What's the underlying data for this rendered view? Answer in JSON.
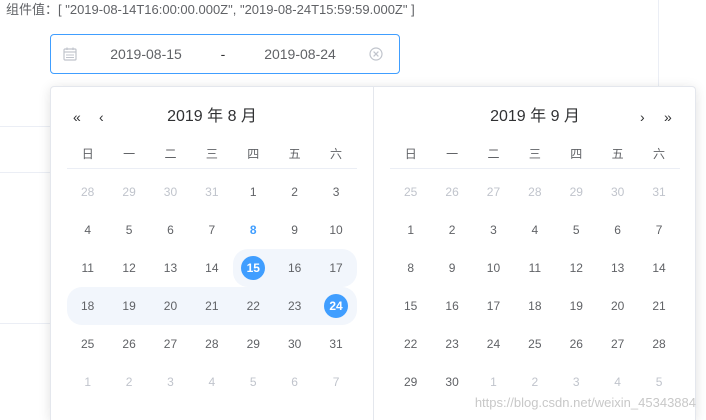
{
  "value_line": "组件值：[ \"2019-08-14T16:00:00.000Z\", \"2019-08-24T15:59:59.000Z\" ]",
  "range_input": {
    "start": "2019-08-15",
    "separator": "-",
    "end": "2019-08-24",
    "calendar_icon": "calendar-icon",
    "clear_icon": "circle-close-icon"
  },
  "left_month": {
    "title": "2019 年 8 月",
    "prev_year": "«",
    "prev_month": "‹",
    "weekdays": [
      "日",
      "一",
      "二",
      "三",
      "四",
      "五",
      "六"
    ],
    "rows": [
      [
        {
          "d": "28",
          "s": "muted"
        },
        {
          "d": "29",
          "s": "muted"
        },
        {
          "d": "30",
          "s": "muted"
        },
        {
          "d": "31",
          "s": "muted"
        },
        {
          "d": "1",
          "s": ""
        },
        {
          "d": "2",
          "s": ""
        },
        {
          "d": "3",
          "s": ""
        }
      ],
      [
        {
          "d": "4",
          "s": ""
        },
        {
          "d": "5",
          "s": ""
        },
        {
          "d": "6",
          "s": ""
        },
        {
          "d": "7",
          "s": ""
        },
        {
          "d": "8",
          "s": "today"
        },
        {
          "d": "9",
          "s": ""
        },
        {
          "d": "10",
          "s": ""
        }
      ],
      [
        {
          "d": "11",
          "s": ""
        },
        {
          "d": "12",
          "s": ""
        },
        {
          "d": "13",
          "s": ""
        },
        {
          "d": "14",
          "s": ""
        },
        {
          "d": "15",
          "s": "start"
        },
        {
          "d": "16",
          "s": "in"
        },
        {
          "d": "17",
          "s": "in-end"
        }
      ],
      [
        {
          "d": "18",
          "s": "in-start"
        },
        {
          "d": "19",
          "s": "in"
        },
        {
          "d": "20",
          "s": "in"
        },
        {
          "d": "21",
          "s": "in"
        },
        {
          "d": "22",
          "s": "in"
        },
        {
          "d": "23",
          "s": "in"
        },
        {
          "d": "24",
          "s": "end"
        }
      ],
      [
        {
          "d": "25",
          "s": ""
        },
        {
          "d": "26",
          "s": ""
        },
        {
          "d": "27",
          "s": ""
        },
        {
          "d": "28",
          "s": ""
        },
        {
          "d": "29",
          "s": ""
        },
        {
          "d": "30",
          "s": ""
        },
        {
          "d": "31",
          "s": ""
        }
      ],
      [
        {
          "d": "1",
          "s": "muted"
        },
        {
          "d": "2",
          "s": "muted"
        },
        {
          "d": "3",
          "s": "muted"
        },
        {
          "d": "4",
          "s": "muted"
        },
        {
          "d": "5",
          "s": "muted"
        },
        {
          "d": "6",
          "s": "muted"
        },
        {
          "d": "7",
          "s": "muted"
        }
      ]
    ]
  },
  "right_month": {
    "title": "2019 年 9 月",
    "next_month": "›",
    "next_year": "»",
    "weekdays": [
      "日",
      "一",
      "二",
      "三",
      "四",
      "五",
      "六"
    ],
    "rows": [
      [
        {
          "d": "25",
          "s": "muted"
        },
        {
          "d": "26",
          "s": "muted"
        },
        {
          "d": "27",
          "s": "muted"
        },
        {
          "d": "28",
          "s": "muted"
        },
        {
          "d": "29",
          "s": "muted"
        },
        {
          "d": "30",
          "s": "muted"
        },
        {
          "d": "31",
          "s": "muted"
        }
      ],
      [
        {
          "d": "1",
          "s": ""
        },
        {
          "d": "2",
          "s": ""
        },
        {
          "d": "3",
          "s": ""
        },
        {
          "d": "4",
          "s": ""
        },
        {
          "d": "5",
          "s": ""
        },
        {
          "d": "6",
          "s": ""
        },
        {
          "d": "7",
          "s": ""
        }
      ],
      [
        {
          "d": "8",
          "s": ""
        },
        {
          "d": "9",
          "s": ""
        },
        {
          "d": "10",
          "s": ""
        },
        {
          "d": "11",
          "s": ""
        },
        {
          "d": "12",
          "s": ""
        },
        {
          "d": "13",
          "s": ""
        },
        {
          "d": "14",
          "s": ""
        }
      ],
      [
        {
          "d": "15",
          "s": ""
        },
        {
          "d": "16",
          "s": ""
        },
        {
          "d": "17",
          "s": ""
        },
        {
          "d": "18",
          "s": ""
        },
        {
          "d": "19",
          "s": ""
        },
        {
          "d": "20",
          "s": ""
        },
        {
          "d": "21",
          "s": ""
        }
      ],
      [
        {
          "d": "22",
          "s": ""
        },
        {
          "d": "23",
          "s": ""
        },
        {
          "d": "24",
          "s": ""
        },
        {
          "d": "25",
          "s": ""
        },
        {
          "d": "26",
          "s": ""
        },
        {
          "d": "27",
          "s": ""
        },
        {
          "d": "28",
          "s": ""
        }
      ],
      [
        {
          "d": "29",
          "s": ""
        },
        {
          "d": "30",
          "s": ""
        },
        {
          "d": "1",
          "s": "muted"
        },
        {
          "d": "2",
          "s": "muted"
        },
        {
          "d": "3",
          "s": "muted"
        },
        {
          "d": "4",
          "s": "muted"
        },
        {
          "d": "5",
          "s": "muted"
        }
      ]
    ]
  },
  "watermark": "https://blog.csdn.net/weixin_45343884",
  "colors": {
    "accent": "#409eff",
    "range_bg": "#f2f6fc",
    "muted_text": "#c0c4cc",
    "text": "#606266"
  }
}
